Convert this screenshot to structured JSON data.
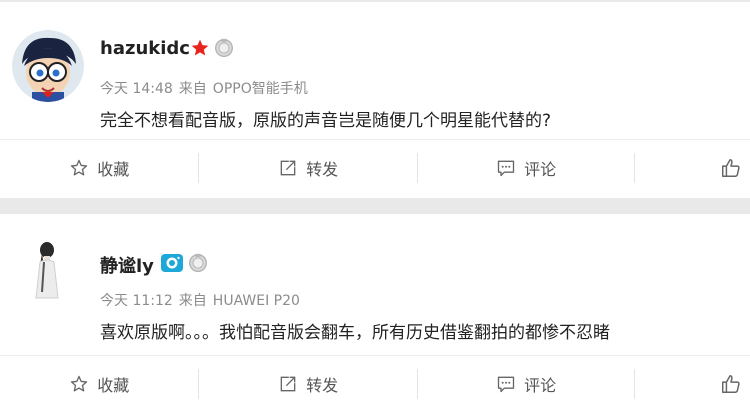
{
  "posts": [
    {
      "username": "hazukidc",
      "time": "今天 14:48",
      "source_prefix": "来自",
      "source": "OPPO智能手机",
      "text": "完全不想看配音版，原版的声音岂是随便几个明星能代替的?",
      "badges": [
        "star-icon",
        "medal-icon"
      ]
    },
    {
      "username": "静谧ly",
      "time": "今天 11:12",
      "source_prefix": "来自",
      "source": "HUAWEI P20",
      "text": "喜欢原版啊。。。我怕配音版会翻车，所有历史借鉴翻拍的都惨不忍睹",
      "badges": [
        "camera-icon",
        "medal-icon"
      ]
    }
  ],
  "actions": {
    "favorite": "收藏",
    "repost": "转发",
    "comment": "评论"
  },
  "colors": {
    "star": "#e8231e",
    "camera": "#1ea8d8",
    "medal": "#b9b9b9"
  }
}
